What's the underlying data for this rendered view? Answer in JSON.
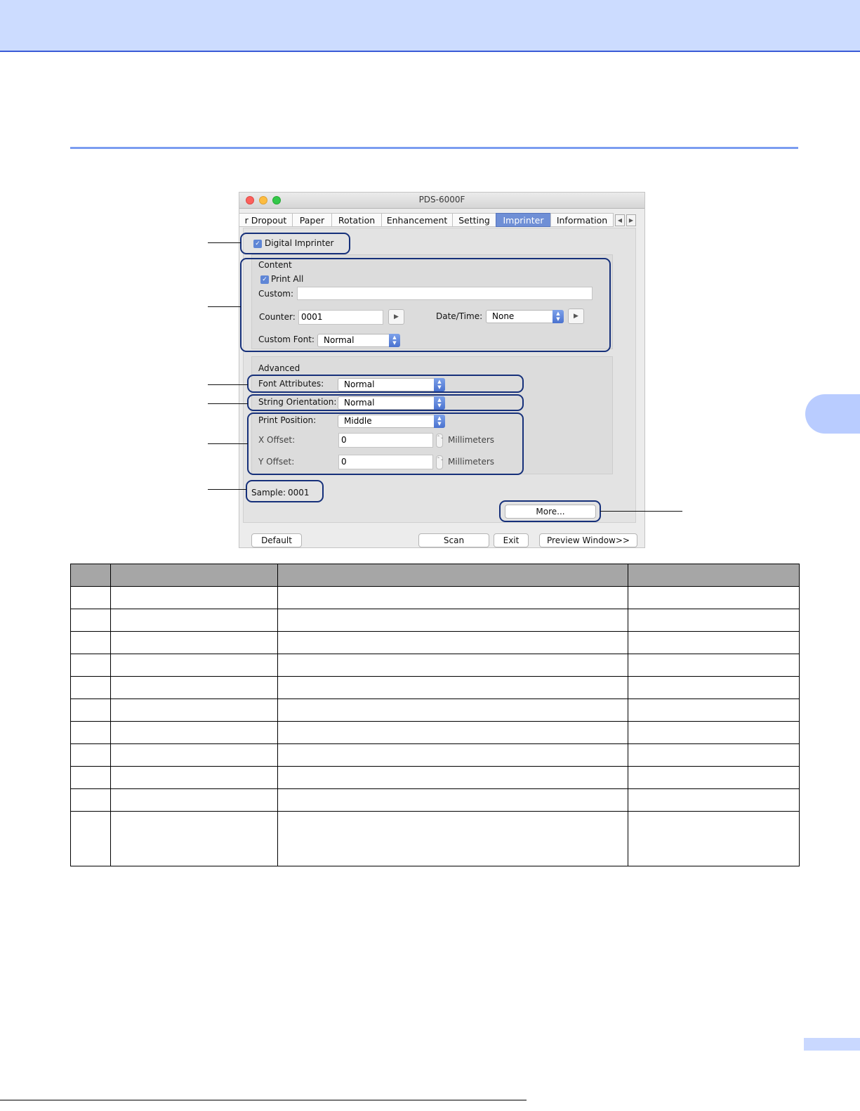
{
  "window": {
    "title": "PDS-6000F",
    "tabs": [
      "r Dropout",
      "Paper",
      "Rotation",
      "Enhancement",
      "Setting",
      "Imprinter",
      "Information"
    ],
    "active_tab": "Imprinter",
    "nav_left_glyph": "◀",
    "nav_right_glyph": "▶"
  },
  "imprinter": {
    "digital_imprinter_label": "Digital Imprinter",
    "digital_imprinter_checked": true,
    "content": {
      "title": "Content",
      "print_all_label": "Print All",
      "print_all_checked": true,
      "custom_label": "Custom:",
      "custom_value": "",
      "counter_label": "Counter:",
      "counter_value": "0001",
      "datetime_label": "Date/Time:",
      "datetime_value": "None",
      "custom_font_label": "Custom Font:",
      "custom_font_value": "Normal"
    },
    "advanced": {
      "title": "Advanced",
      "font_attributes_label": "Font Attributes:",
      "font_attributes_value": "Normal",
      "string_orientation_label": "String Orientation:",
      "string_orientation_value": "Normal",
      "print_position_label": "Print Position:",
      "print_position_value": "Middle",
      "x_offset_label": "X Offset:",
      "x_offset_value": "0",
      "y_offset_label": "Y Offset:",
      "y_offset_value": "0",
      "unit_label": "Millimeters"
    },
    "sample_label": "Sample:",
    "sample_value": "0001",
    "more_button": "More..."
  },
  "bottom_buttons": {
    "default": "Default",
    "scan": "Scan",
    "exit": "Exit",
    "preview": "Preview Window>>"
  },
  "glyphs": {
    "check": "✓",
    "play": "▶",
    "stepper": "⌃⌄"
  },
  "colors": {
    "top_band": "#ccdcff",
    "accent_rule": "#7b9df0",
    "active_tab": "#6f8fd6",
    "callout_border": "#16307a",
    "table_header": "#a6a6a6"
  },
  "table": {
    "column_count": 4,
    "row_count": 11
  }
}
